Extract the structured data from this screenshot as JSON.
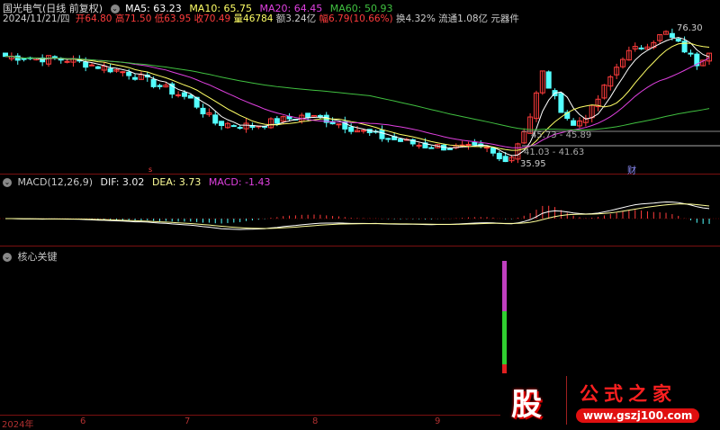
{
  "header": {
    "title": "国光电气(日线 前复权)",
    "ma5": "MA5: 63.23",
    "ma10": "MA10: 65.75",
    "ma20": "MA20: 64.45",
    "ma60": "MA60: 50.93",
    "date": "2024/11/21/四",
    "open": "开64.80",
    "high": "高71.50",
    "low": "低63.95",
    "close": "收70.49",
    "volume": "量46784",
    "amount": "额3.24亿",
    "change": "幅6.79(10.66%)",
    "turnover": "换4.32%",
    "float": "流通1.08亿",
    "sector": "元器件"
  },
  "annotations": {
    "high": "76.30",
    "low": "35.95",
    "range1": "45.73 - 45.89",
    "range2": "41.03 - 41.63",
    "marker_cai": "财",
    "marker_s": "s"
  },
  "macd": {
    "label": "MACD(12,26,9)",
    "dif": "DIF: 3.02",
    "dea": "DEA: 3.73",
    "macd": "MACD: -1.43"
  },
  "indicator": {
    "label": "核心关键"
  },
  "xaxis": {
    "labels": [
      "2024年",
      "6",
      "7",
      "8",
      "9"
    ]
  },
  "logo": {
    "char": "股",
    "name": "公式之家",
    "url": "www.gszj100.com"
  },
  "colors": {
    "up": "#ff3c3c",
    "down": "#54ffff",
    "ma5": "#ffffff",
    "ma10": "#ffff66",
    "ma20": "#e040e0",
    "ma60": "#40c040"
  },
  "price_keypoints": [
    [
      0,
      68
    ],
    [
      10,
      67
    ],
    [
      20,
      63
    ],
    [
      30,
      55
    ],
    [
      34,
      48
    ],
    [
      40,
      47
    ],
    [
      48,
      50
    ],
    [
      52,
      49
    ],
    [
      60,
      44
    ],
    [
      68,
      41
    ],
    [
      78,
      40
    ],
    [
      80,
      37
    ],
    [
      82,
      38
    ],
    [
      85,
      50
    ],
    [
      87,
      63
    ],
    [
      89,
      55
    ],
    [
      92,
      47
    ],
    [
      95,
      52
    ],
    [
      100,
      68
    ],
    [
      104,
      72
    ],
    [
      107,
      75
    ],
    [
      110,
      70
    ],
    [
      112,
      66
    ],
    [
      114,
      70
    ]
  ]
}
